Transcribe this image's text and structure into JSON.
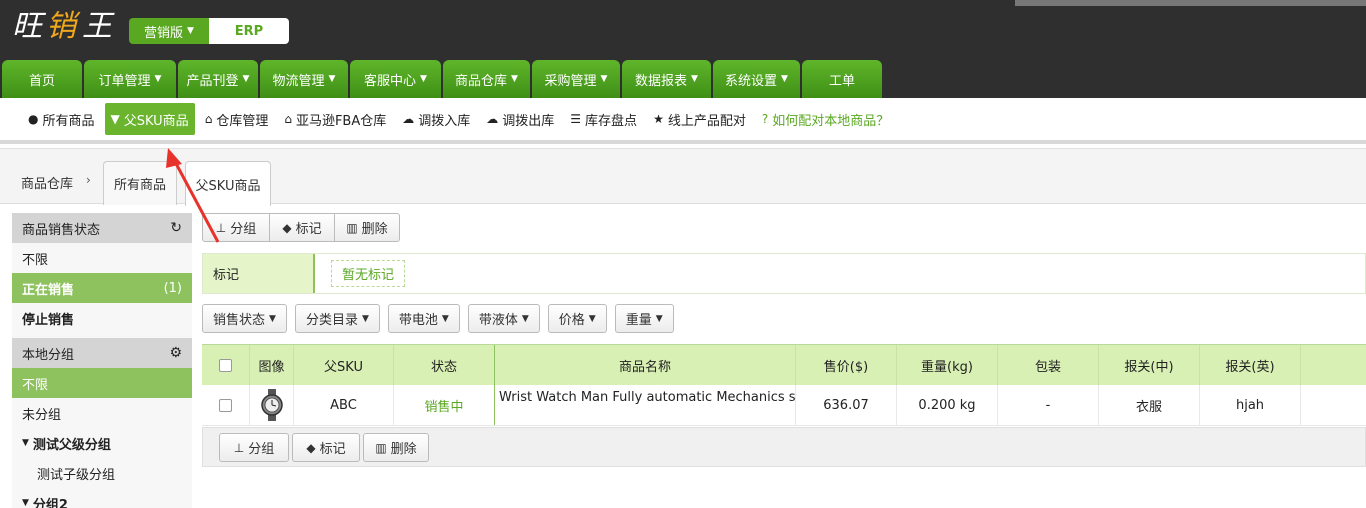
{
  "brand": {
    "logo_text": "旺销王"
  },
  "edition": {
    "selected": "营销版",
    "erp": "ERP"
  },
  "main_nav": [
    "首页",
    "订单管理",
    "产品刊登",
    "物流管理",
    "客服中心",
    "商品仓库",
    "采购管理",
    "数据报表",
    "系统设置",
    "工单"
  ],
  "sub_nav": {
    "items": [
      "所有商品",
      "父SKU商品",
      "仓库管理",
      "亚马逊FBA仓库",
      "调拨入库",
      "调拨出库",
      "库存盘点",
      "线上产品配对"
    ],
    "help": "如何配对本地商品？"
  },
  "breadcrumb": {
    "root": "商品仓库",
    "tabs": [
      "所有商品",
      "父SKU商品"
    ]
  },
  "sidebar": {
    "sales_status": {
      "title": "商品销售状态",
      "items": [
        {
          "label": "不限",
          "count": ""
        },
        {
          "label": "正在销售",
          "count": "(1)"
        },
        {
          "label": "停止销售",
          "count": ""
        }
      ]
    },
    "local_group": {
      "title": "本地分组",
      "items": [
        "不限",
        "未分组",
        "测试父级分组",
        "测试子级分组",
        "分组2"
      ]
    }
  },
  "toolbar": {
    "group": "分组",
    "mark": "标记",
    "delete": "删除"
  },
  "tags": {
    "label": "标记",
    "empty": "暂无标记"
  },
  "filters": [
    "销售状态",
    "分类目录",
    "带电池",
    "带液体",
    "价格",
    "重量"
  ],
  "table": {
    "headers": [
      "图像",
      "父SKU",
      "状态",
      "商品名称",
      "售价($)",
      "重量(kg)",
      "包装",
      "报关(中)",
      "报关(英)"
    ],
    "rows": [
      {
        "sku": "ABC",
        "status": "销售中",
        "name": "Wrist Watch Man Fully automatic Mechanics su",
        "price": "636.07",
        "weight": "0.200 kg",
        "package": "-",
        "customs_cn": "衣服",
        "customs_en": "hjah"
      }
    ]
  },
  "colors": {
    "green": "#5aa821",
    "dark_header": "#2f2f2f",
    "annotation": "#e8322c"
  }
}
